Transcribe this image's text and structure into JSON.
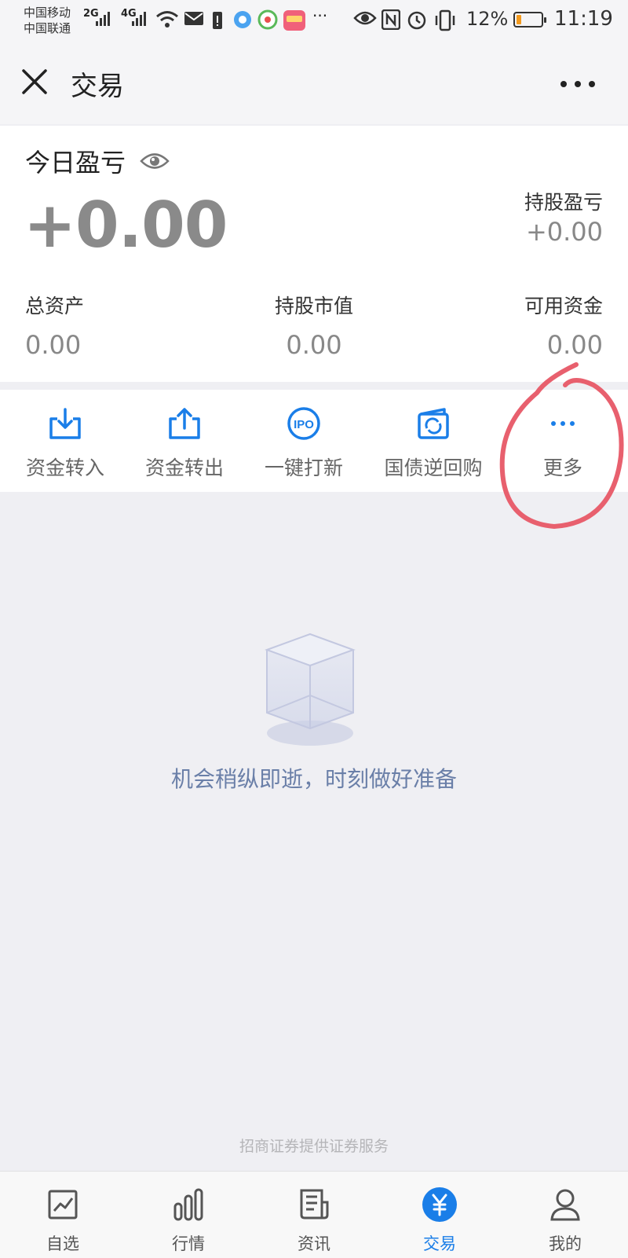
{
  "status_bar": {
    "carrier_1": "中国移动",
    "carrier_2": "中国联通",
    "net_1": "2G",
    "net_2": "4G",
    "more_indicator": "···",
    "battery_percent": "12%",
    "battery_level": 0.12,
    "time": "11:19"
  },
  "header": {
    "title": "交易"
  },
  "summary": {
    "today_pl_label": "今日盈亏",
    "today_pl_value": "+0.00",
    "holding_pl_label": "持股盈亏",
    "holding_pl_value": "+0.00",
    "stats": [
      {
        "label": "总资产",
        "value": "0.00"
      },
      {
        "label": "持股市值",
        "value": "0.00"
      },
      {
        "label": "可用资金",
        "value": "0.00"
      }
    ]
  },
  "actions": [
    {
      "label": "资金转入",
      "icon": "transfer-in-icon"
    },
    {
      "label": "资金转出",
      "icon": "transfer-out-icon"
    },
    {
      "label": "一键打新",
      "icon": "ipo-icon"
    },
    {
      "label": "国债逆回购",
      "icon": "reverse-repo-icon"
    },
    {
      "label": "更多",
      "icon": "more-dots-icon"
    }
  ],
  "empty_state": {
    "message": "机会稍纵即逝，时刻做好准备",
    "icon": "empty-box-icon"
  },
  "provider_note": "招商证券提供证券服务",
  "tabbar": {
    "tabs": [
      {
        "label": "自选",
        "icon": "watchlist-icon",
        "active": false
      },
      {
        "label": "行情",
        "icon": "market-icon",
        "active": false
      },
      {
        "label": "资讯",
        "icon": "news-icon",
        "active": false
      },
      {
        "label": "交易",
        "icon": "trade-icon",
        "active": true
      },
      {
        "label": "我的",
        "icon": "profile-icon",
        "active": false
      }
    ]
  },
  "colors": {
    "accent": "#1a7ee8",
    "annotation_circle": "#e8606e",
    "empty_text": "#6a7fa8"
  }
}
